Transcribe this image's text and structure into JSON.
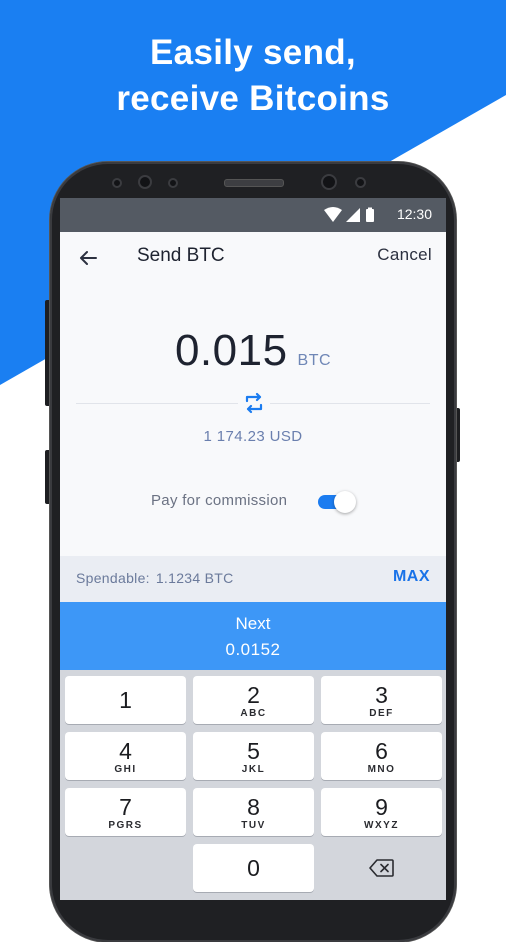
{
  "headline": {
    "line1": "Easily send,",
    "line2": "receive Bitcoins"
  },
  "status_bar": {
    "time": "12:30",
    "icons": [
      "wifi-icon",
      "signal-icon",
      "battery-icon"
    ]
  },
  "app_bar": {
    "title": "Send BTC",
    "cancel_label": "Cancel",
    "back_icon": "arrow-left-icon"
  },
  "amount": {
    "value": "0.015",
    "unit": "BTC",
    "swap_icon": "swap-icon",
    "fiat_value": "1 174.23 USD"
  },
  "commission": {
    "label": "Pay for commission",
    "enabled": true
  },
  "spendable": {
    "label": "Spendable:",
    "value": "1.1234 BTC",
    "max_label": "MAX"
  },
  "next": {
    "label": "Next",
    "value": "0.0152"
  },
  "keypad": {
    "keys": [
      {
        "digit": "1",
        "letters": ""
      },
      {
        "digit": "2",
        "letters": "ABC"
      },
      {
        "digit": "3",
        "letters": "DEF"
      },
      {
        "digit": "4",
        "letters": "GHI"
      },
      {
        "digit": "5",
        "letters": "JKL"
      },
      {
        "digit": "6",
        "letters": "MNO"
      },
      {
        "digit": "7",
        "letters": "PGRS"
      },
      {
        "digit": "8",
        "letters": "TUV"
      },
      {
        "digit": "9",
        "letters": "WXYZ"
      },
      {
        "digit": "0",
        "letters": ""
      }
    ],
    "backspace_icon": "backspace-icon"
  },
  "colors": {
    "brand_blue": "#1a7ff2",
    "accent": "#1b7cf0",
    "next_button": "#3d97f7",
    "status_bar": "#545a63"
  }
}
